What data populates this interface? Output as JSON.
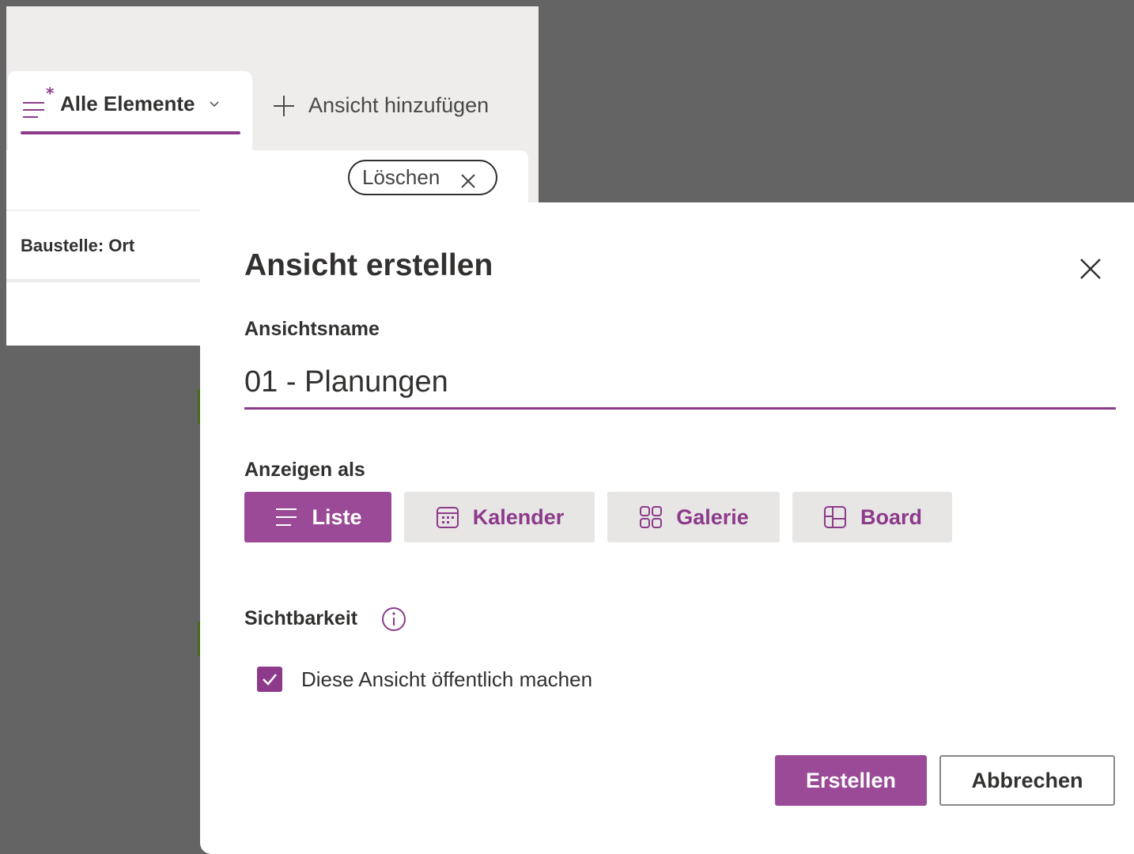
{
  "background": {
    "view_tab": {
      "label": "Alle Elemente",
      "icon": "list-modified-icon"
    },
    "add_view": {
      "label": "Ansicht hinzufügen",
      "icon": "plus-icon"
    },
    "delete_filter": {
      "label": "Löschen",
      "icon": "close-icon"
    },
    "column_label": "Baustelle: Ort"
  },
  "dialog": {
    "title": "Ansicht erstellen",
    "name_label": "Ansichtsname",
    "name_value": "01 - Planungen",
    "display_as_label": "Anzeigen als",
    "display_options": [
      {
        "label": "Liste",
        "icon": "list-icon",
        "selected": true
      },
      {
        "label": "Kalender",
        "icon": "calendar-icon",
        "selected": false
      },
      {
        "label": "Galerie",
        "icon": "gallery-icon",
        "selected": false
      },
      {
        "label": "Board",
        "icon": "board-icon",
        "selected": false
      }
    ],
    "visibility_label": "Sichtbarkeit",
    "public_checkbox": {
      "label": "Diese Ansicht öffentlich machen",
      "checked": true
    },
    "create_label": "Erstellen",
    "cancel_label": "Abbrechen"
  },
  "colors": {
    "accent": "#8d3a8b",
    "accent_button": "#9a4a96",
    "overlay": "#646464"
  }
}
